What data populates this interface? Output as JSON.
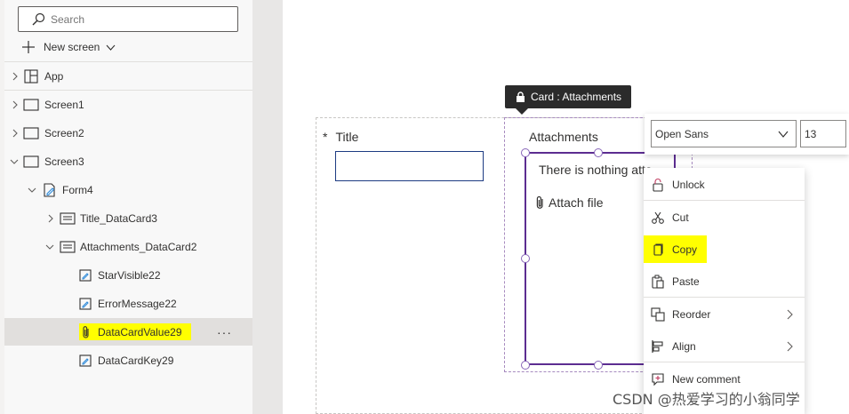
{
  "tree_view": {
    "search": {
      "placeholder": "Search",
      "value": ""
    },
    "new_screen_label": "New screen",
    "items": [
      {
        "label": "App"
      },
      {
        "label": "Screen1"
      },
      {
        "label": "Screen2"
      },
      {
        "label": "Screen3"
      },
      {
        "label": "Form4"
      },
      {
        "label": "Title_DataCard3"
      },
      {
        "label": "Attachments_DataCard2"
      },
      {
        "label": "StarVisible22"
      },
      {
        "label": "ErrorMessage22"
      },
      {
        "label": "DataCardValue29",
        "selected": true,
        "highlighted": true
      },
      {
        "label": "DataCardKey29"
      }
    ],
    "more_label": "···"
  },
  "canvas": {
    "tooltip": "Card : Attachments",
    "title_card": {
      "required_mark": "*",
      "label": "Title",
      "value": ""
    },
    "attachments_card": {
      "label": "Attachments",
      "empty_text": "There is nothing atta",
      "attach_file_label": "Attach file"
    }
  },
  "font_toolbar": {
    "font_family": "Open Sans",
    "font_size": "13"
  },
  "context_menu": {
    "items": [
      {
        "label": "Unlock",
        "icon": "lock-open-icon"
      },
      {
        "label": "Cut",
        "icon": "scissors-icon"
      },
      {
        "label": "Copy",
        "icon": "copy-icon",
        "highlighted": true
      },
      {
        "label": "Paste",
        "icon": "paste-icon"
      },
      {
        "label": "Reorder",
        "icon": "reorder-icon",
        "submenu": true
      },
      {
        "label": "Align",
        "icon": "align-icon",
        "submenu": true
      },
      {
        "label": "New comment",
        "icon": "comment-icon"
      }
    ]
  },
  "watermark": "CSDN @热爱学习的小翁同学",
  "colors": {
    "selection_purple": "#5c2d91",
    "highlight_yellow": "#ffff00",
    "input_border_blue": "#1d3b82"
  }
}
